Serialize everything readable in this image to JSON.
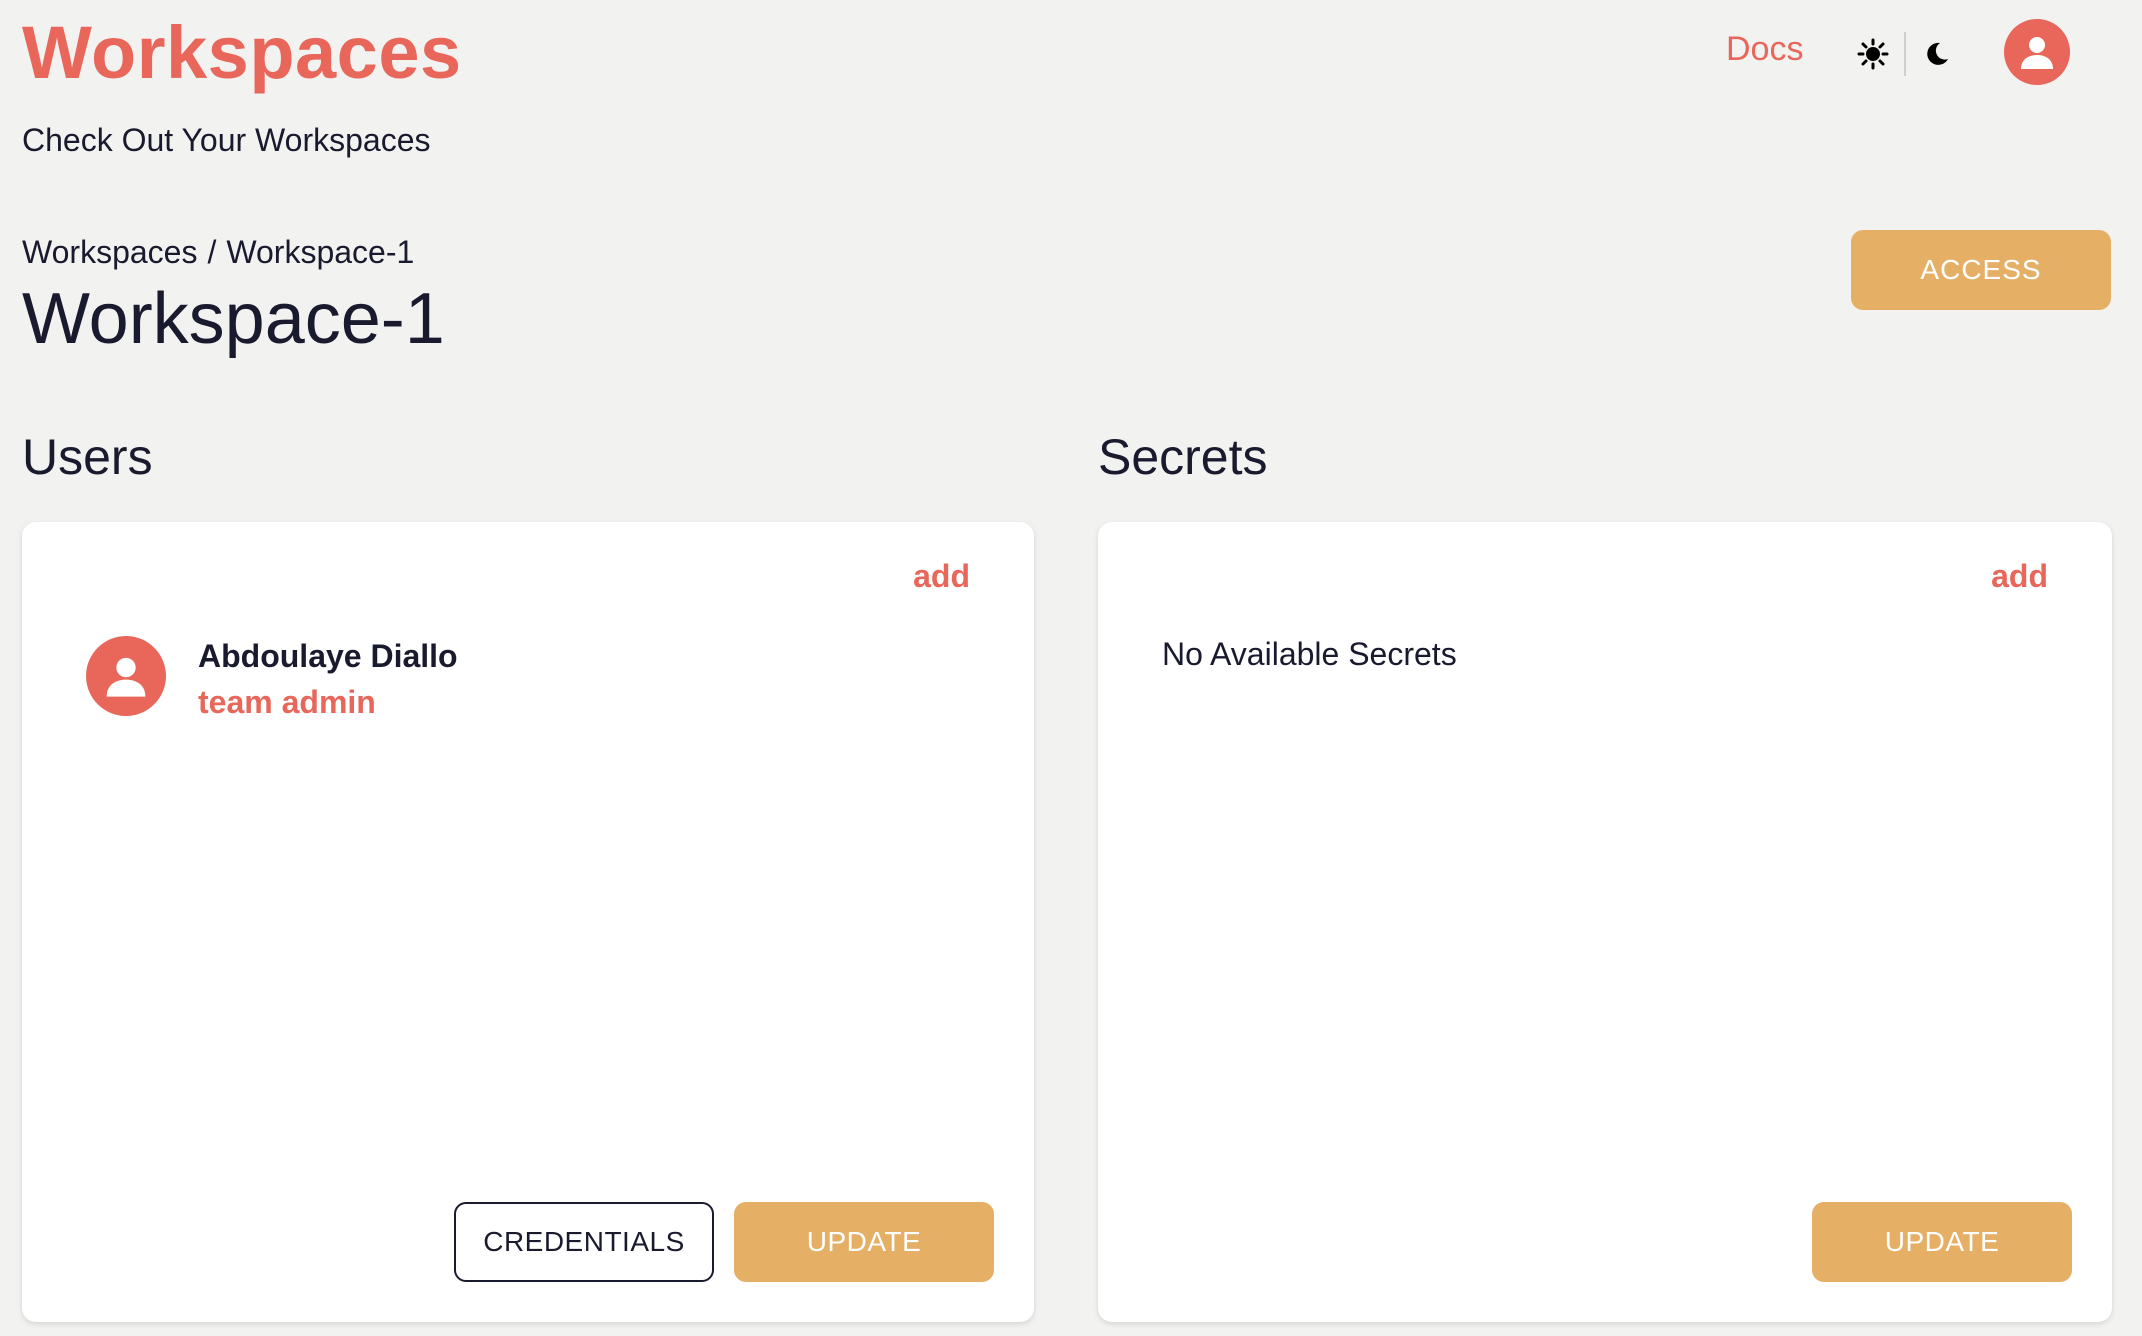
{
  "header": {
    "title": "Workspaces",
    "subtitle": "Check Out Your Workspaces",
    "docs_label": "Docs",
    "theme_icons": [
      "sun-icon",
      "moon-icon"
    ],
    "avatar_icon": "account-icon"
  },
  "breadcrumb": {
    "root": "Workspaces",
    "separator": "/",
    "current": "Workspace-1"
  },
  "workspace": {
    "title": "Workspace-1",
    "access_label": "ACCESS"
  },
  "users": {
    "heading": "Users",
    "add_label": "add",
    "items": [
      {
        "name": "Abdoulaye Diallo",
        "role": "team admin",
        "icon": "account-icon"
      }
    ],
    "credentials_label": "CREDENTIALS",
    "update_label": "UPDATE"
  },
  "secrets": {
    "heading": "Secrets",
    "add_label": "add",
    "empty_text": "No Available Secrets",
    "update_label": "UPDATE"
  },
  "colors": {
    "accent": "#e8665a",
    "button": "#e5b066",
    "background": "#f2f2f1",
    "text": "#1a1a2e"
  }
}
